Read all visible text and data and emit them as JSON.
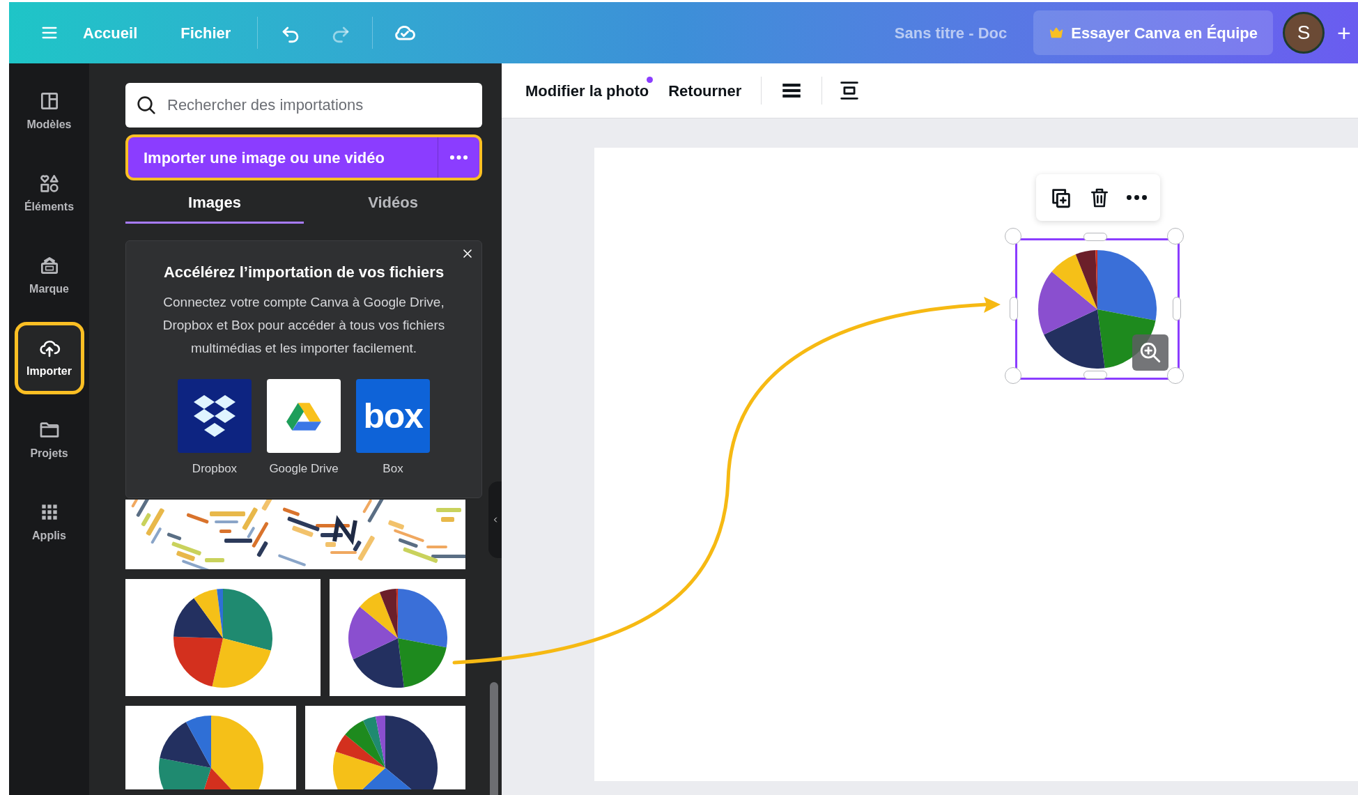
{
  "top_bar": {
    "nav": [
      {
        "label": "Accueil"
      },
      {
        "label": "Fichier"
      }
    ],
    "document_title": "Sans titre - Doc",
    "team_button": "Essayer Canva en Équipe",
    "avatar_initial": "S",
    "add_label": "+"
  },
  "sidebar": {
    "items": [
      {
        "label": "Modèles",
        "selected": false,
        "highlighted": false
      },
      {
        "label": "Éléments",
        "selected": false,
        "highlighted": false
      },
      {
        "label": "Marque",
        "selected": false,
        "highlighted": false
      },
      {
        "label": "Importer",
        "selected": true,
        "highlighted": true
      },
      {
        "label": "Projets",
        "selected": false,
        "highlighted": false
      },
      {
        "label": "Applis",
        "selected": false,
        "highlighted": false
      }
    ]
  },
  "panel": {
    "search": {
      "placeholder": "Rechercher des importations"
    },
    "upload_button": {
      "label": "Importer une image ou une vidéo",
      "highlighted": true
    },
    "tabs": [
      {
        "label": "Images",
        "selected": true
      },
      {
        "label": "Vidéos",
        "selected": false
      }
    ],
    "promo": {
      "title": "Accélérez l’importation de vos fichiers",
      "text": "Connectez votre compte Canva à Google Drive, Dropbox et Box pour accéder à tous vos fichiers multimédias et les importer facilement.",
      "services": [
        {
          "label": "Dropbox",
          "kind": "dropbox"
        },
        {
          "label": "Google Drive",
          "kind": "drive"
        },
        {
          "label": "Box",
          "kind": "box",
          "logo_text": "box"
        }
      ]
    },
    "thumbnails": [
      {
        "kind": "word-cloud"
      },
      {
        "kind": "pie"
      },
      {
        "kind": "pie"
      },
      {
        "kind": "pie"
      },
      {
        "kind": "pie"
      }
    ]
  },
  "toolbar": {
    "items": [
      {
        "label": "Modifier la photo",
        "badge": true
      },
      {
        "label": "Retourner",
        "badge": false
      }
    ]
  },
  "canvas": {
    "element": {
      "kind": "pie",
      "selected": true
    }
  }
}
